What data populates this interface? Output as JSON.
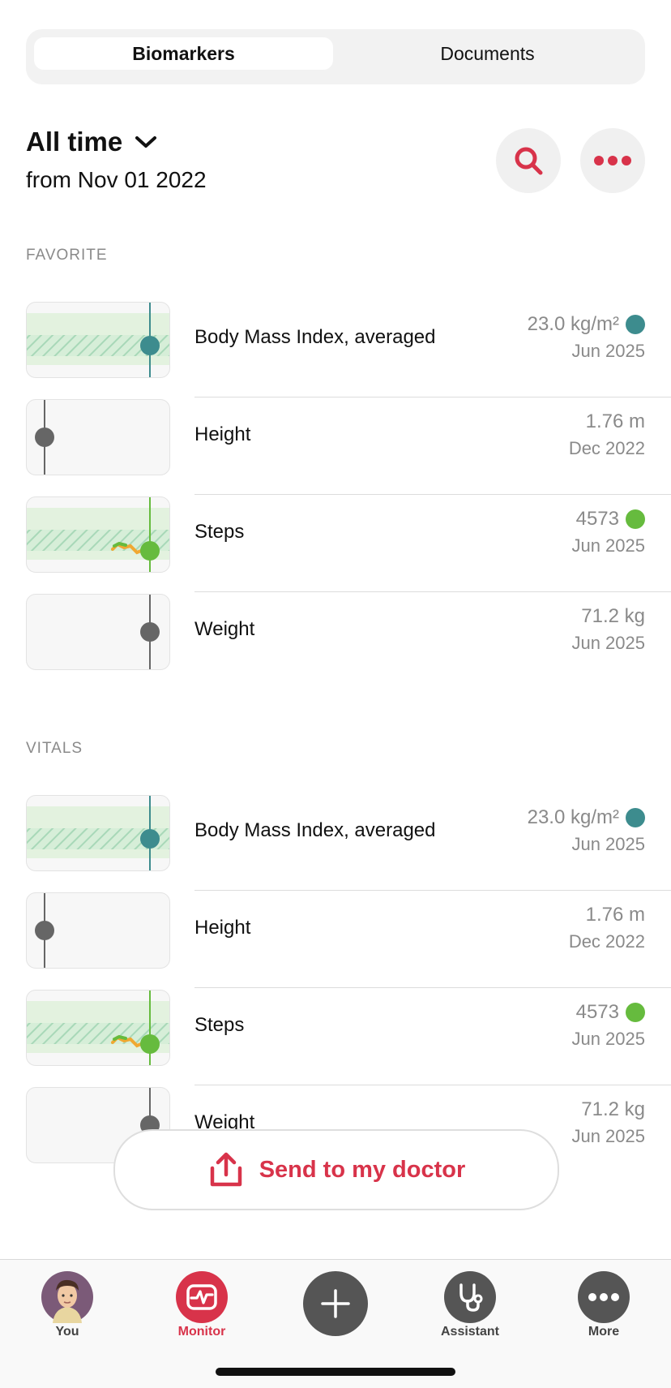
{
  "tabs": {
    "active": "Biomarkers",
    "inactive": "Documents"
  },
  "range": {
    "title": "All time",
    "from": "from Nov 01 2022"
  },
  "icons": {
    "search": "search-icon",
    "more": "more-dots-icon",
    "chevron": "chevron-down-icon",
    "share": "share-upload-icon"
  },
  "colors": {
    "accent": "#d8334a",
    "teal": "#3d8c8e",
    "green": "#66bb3e",
    "gray": "#666666",
    "range_band": "#e3f2df",
    "hatch": "#a8d8b8"
  },
  "sections": [
    {
      "title": "FAVORITE",
      "items": [
        {
          "label": "Body Mass Index, averaged",
          "value": "23.0 kg/m²",
          "date": "Jun 2025",
          "status": "teal"
        },
        {
          "label": "Height",
          "value": "1.76 m",
          "date": "Dec 2022",
          "status": "none"
        },
        {
          "label": "Steps",
          "value": "4573",
          "date": "Jun 2025",
          "status": "green"
        },
        {
          "label": "Weight",
          "value": "71.2 kg",
          "date": "Jun 2025",
          "status": "none"
        }
      ]
    },
    {
      "title": "VITALS",
      "items": [
        {
          "label": "Body Mass Index, averaged",
          "value": "23.0 kg/m²",
          "date": "Jun 2025",
          "status": "teal"
        },
        {
          "label": "Height",
          "value": "1.76 m",
          "date": "Dec 2022",
          "status": "none"
        },
        {
          "label": "Steps",
          "value": "4573",
          "date": "Jun 2025",
          "status": "green"
        },
        {
          "label": "Weight",
          "value": "71.2 kg",
          "date": "Jun 2025",
          "status": "none"
        }
      ]
    }
  ],
  "send_button": {
    "label": "Send to my doctor"
  },
  "bottom_nav": [
    {
      "label": "You",
      "icon": "avatar"
    },
    {
      "label": "Monitor",
      "icon": "monitor-icon",
      "active": true
    },
    {
      "label": "",
      "icon": "add-icon"
    },
    {
      "label": "Assistant",
      "icon": "stethoscope-icon"
    },
    {
      "label": "More",
      "icon": "more-dots-icon"
    }
  ]
}
